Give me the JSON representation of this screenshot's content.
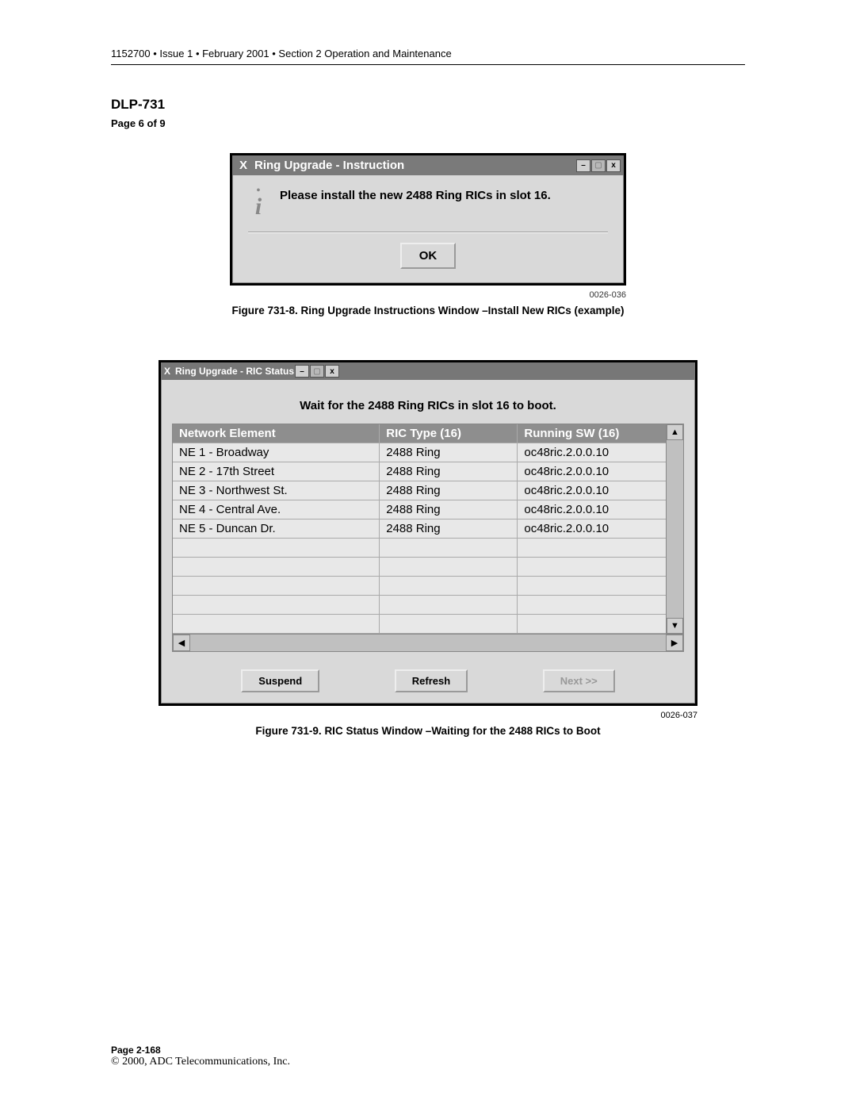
{
  "header": "1152700 • Issue 1 • February 2001 • Section 2 Operation and Maintenance",
  "dlp_title": "DLP-731",
  "page_of": "Page 6 of 9",
  "window1": {
    "title": "Ring Upgrade - Instruction",
    "message": "Please install the new 2488 Ring RICs in slot 16.",
    "ok_label": "OK"
  },
  "fig1_code": "0026-036",
  "fig1_caption": "Figure 731-8. Ring Upgrade Instructions Window –Install New RICs (example)",
  "window2": {
    "title": "Ring Upgrade - RIC Status",
    "wait_msg": "Wait for the 2488 Ring RICs in slot 16 to boot.",
    "cols": {
      "c1": "Network Element",
      "c2": "RIC Type (16)",
      "c3": "Running SW (16)"
    },
    "rows": [
      {
        "ne": "NE 1 - Broadway",
        "type": "2488 Ring",
        "sw": "oc48ric.2.0.0.10"
      },
      {
        "ne": "NE 2 - 17th Street",
        "type": "2488 Ring",
        "sw": "oc48ric.2.0.0.10"
      },
      {
        "ne": "NE 3 - Northwest St.",
        "type": "2488 Ring",
        "sw": "oc48ric.2.0.0.10"
      },
      {
        "ne": "NE 4 - Central Ave.",
        "type": "2488 Ring",
        "sw": "oc48ric.2.0.0.10"
      },
      {
        "ne": "NE 5 - Duncan Dr.",
        "type": "2488 Ring",
        "sw": "oc48ric.2.0.0.10"
      },
      {
        "ne": "",
        "type": "",
        "sw": ""
      },
      {
        "ne": "",
        "type": "",
        "sw": ""
      },
      {
        "ne": "",
        "type": "",
        "sw": ""
      },
      {
        "ne": "",
        "type": "",
        "sw": ""
      },
      {
        "ne": "",
        "type": "",
        "sw": ""
      }
    ],
    "buttons": {
      "suspend": "Suspend",
      "refresh": "Refresh",
      "next": "Next >>"
    }
  },
  "fig2_code": "0026-037",
  "fig2_caption": "Figure 731-9. RIC Status Window –Waiting for the 2488 RICs to Boot",
  "footer": {
    "page": "Page 2-168",
    "copyright": "© 2000, ADC Telecommunications, Inc."
  }
}
